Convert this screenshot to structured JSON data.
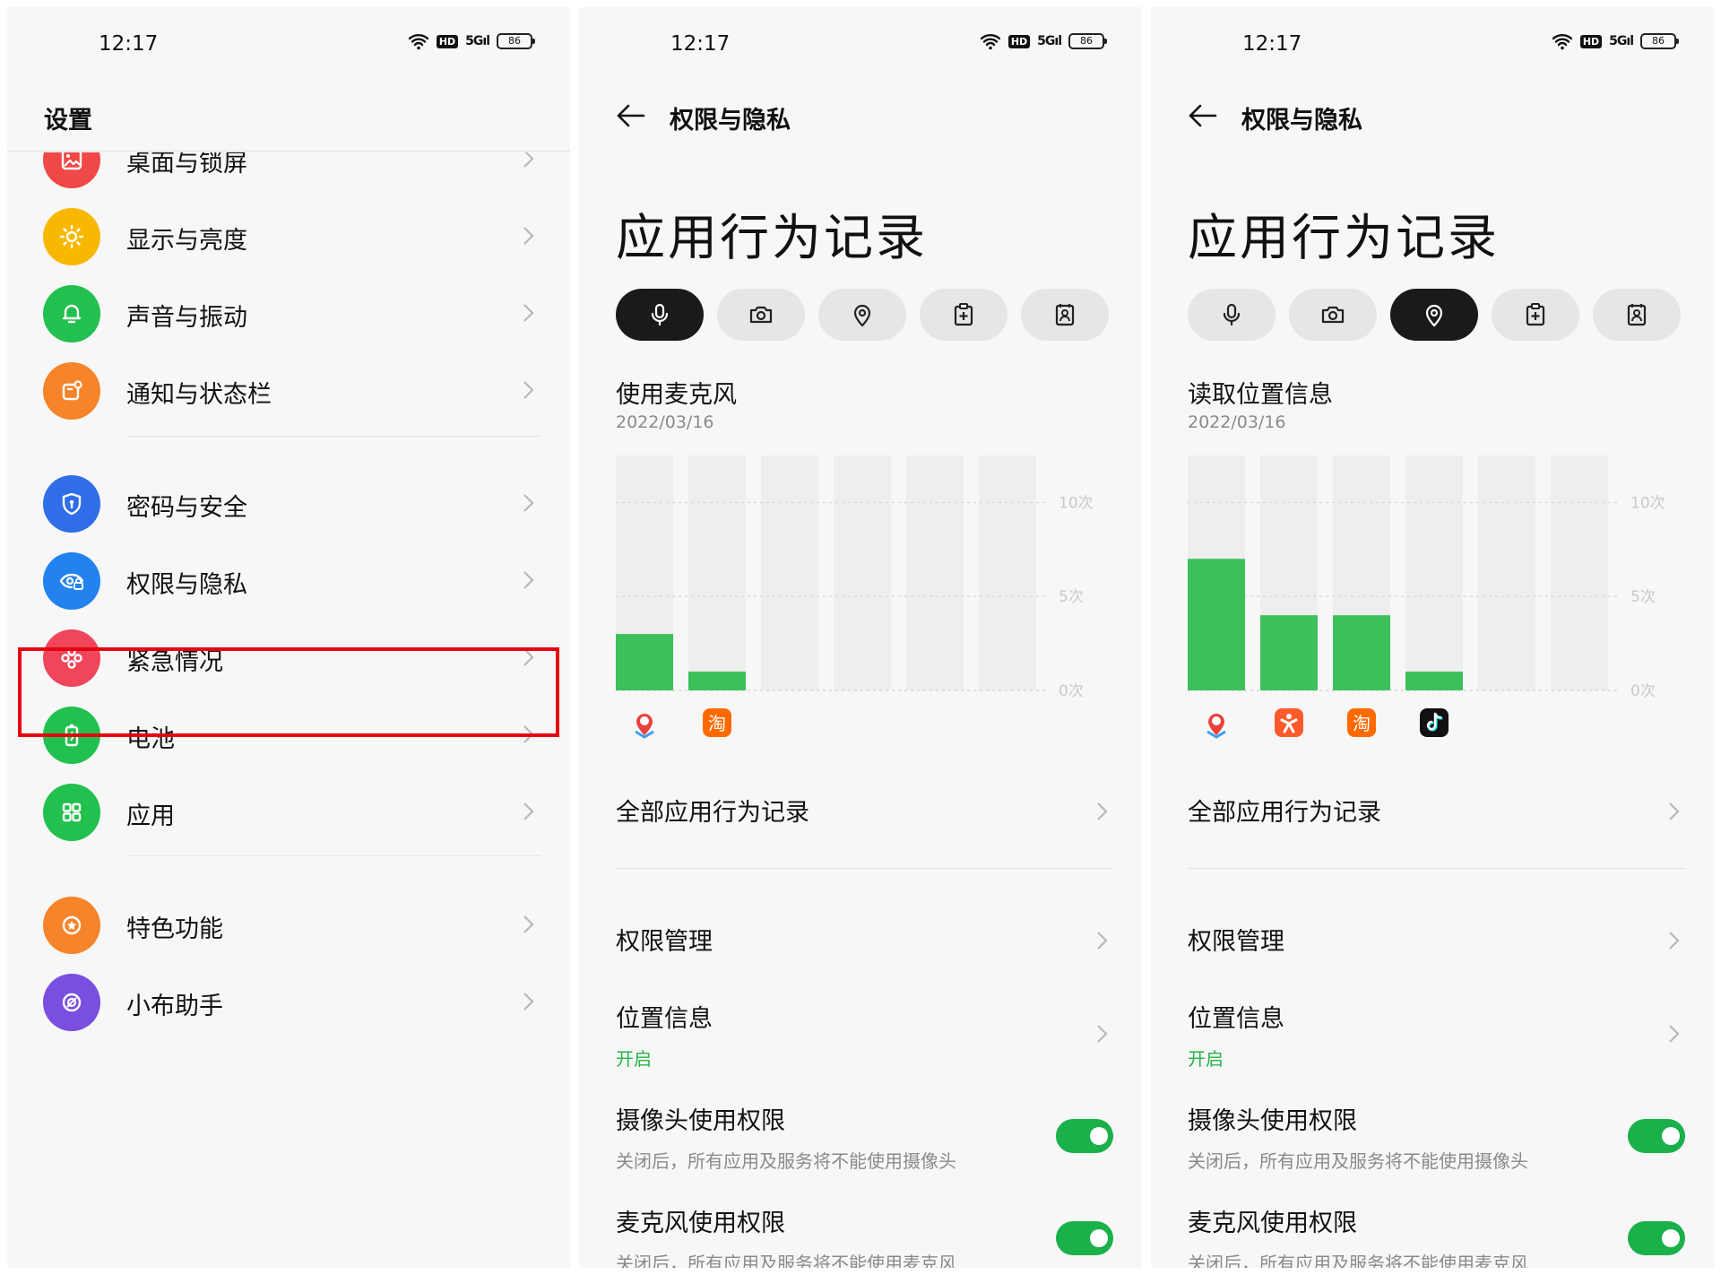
{
  "colors": {
    "accent_green": "#1ab04a",
    "bar_green": "#3cc05a",
    "highlight_red": "#e60012",
    "pill_active": "#1a1a1a"
  },
  "status_bar": {
    "time": "12:17",
    "hd": "HD",
    "signal": "5G",
    "battery": "86"
  },
  "settings": {
    "title": "设置",
    "items": [
      {
        "label": "桌面与锁屏",
        "icon": "wallpaper-icon",
        "color": "#f04747"
      },
      {
        "label": "显示与亮度",
        "icon": "sun-icon",
        "color": "#f8b800"
      },
      {
        "label": "声音与振动",
        "icon": "bell-icon",
        "color": "#22c04e"
      },
      {
        "label": "通知与状态栏",
        "icon": "notification-icon",
        "color": "#f6842a"
      },
      {
        "label": "密码与安全",
        "icon": "shield-icon",
        "color": "#2f6ee8"
      },
      {
        "label": "权限与隐私",
        "icon": "privacy-eye-icon",
        "color": "#2283ee"
      },
      {
        "label": "紧急情况",
        "icon": "sos-icon",
        "color": "#f0455a"
      },
      {
        "label": "电池",
        "icon": "battery-icon",
        "color": "#22c04e"
      },
      {
        "label": "应用",
        "icon": "apps-grid-icon",
        "color": "#22c04e"
      },
      {
        "label": "特色功能",
        "icon": "star-icon",
        "color": "#f6842a"
      },
      {
        "label": "小布助手",
        "icon": "assistant-icon",
        "color": "#7a4fe0"
      }
    ]
  },
  "privacy_mic": {
    "header": "权限与隐私",
    "title": "应用行为记录",
    "categories": [
      "mic-icon",
      "camera-icon",
      "location-icon",
      "clipboard-icon",
      "contacts-icon"
    ],
    "active_category": 0,
    "metric_label": "使用麦克风",
    "date": "2022/03/16",
    "all_records": "全部应用行为记录",
    "permission_mgmt": "权限管理",
    "location": {
      "label": "位置信息",
      "status": "开启"
    },
    "camera_perm": {
      "label": "摄像头使用权限",
      "desc": "关闭后，所有应用及服务将不能使用摄像头",
      "on": true
    },
    "mic_perm": {
      "label": "麦克风使用权限",
      "desc": "关闭后，所有应用及服务将不能使用麦克风",
      "on": true
    }
  },
  "privacy_loc": {
    "header": "权限与隐私",
    "title": "应用行为记录",
    "categories": [
      "mic-icon",
      "camera-icon",
      "location-icon",
      "clipboard-icon",
      "contacts-icon"
    ],
    "active_category": 2,
    "metric_label": "读取位置信息",
    "date": "2022/03/16",
    "all_records": "全部应用行为记录",
    "permission_mgmt": "权限管理",
    "location": {
      "label": "位置信息",
      "status": "开启"
    },
    "camera_perm": {
      "label": "摄像头使用权限",
      "desc": "关闭后，所有应用及服务将不能使用摄像头",
      "on": true
    },
    "mic_perm": {
      "label": "麦克风使用权限",
      "desc": "关闭后，所有应用及服务将不能使用麦克风",
      "on": true
    }
  },
  "chart_data": [
    {
      "type": "bar",
      "y_ticks": [
        "10次",
        "5次",
        "0次"
      ],
      "ylim": [
        0,
        12.5
      ],
      "grid": true,
      "series": [
        {
          "values": [
            3,
            1,
            0,
            0,
            0,
            0
          ]
        }
      ],
      "app_icons": [
        {
          "icon": "baidu-map-icon",
          "text": ""
        },
        {
          "icon": "taobao-icon",
          "text": "淘"
        }
      ]
    },
    {
      "type": "bar",
      "y_ticks": [
        "10次",
        "5次",
        "0次"
      ],
      "ylim": [
        0,
        12.5
      ],
      "grid": true,
      "series": [
        {
          "values": [
            7,
            4,
            4,
            1,
            0,
            0
          ]
        }
      ],
      "app_icons": [
        {
          "icon": "baidu-map-icon",
          "text": ""
        },
        {
          "icon": "keep-app-icon",
          "text": ""
        },
        {
          "icon": "taobao-icon",
          "text": "淘"
        },
        {
          "icon": "tiktok-icon",
          "text": ""
        }
      ]
    }
  ]
}
